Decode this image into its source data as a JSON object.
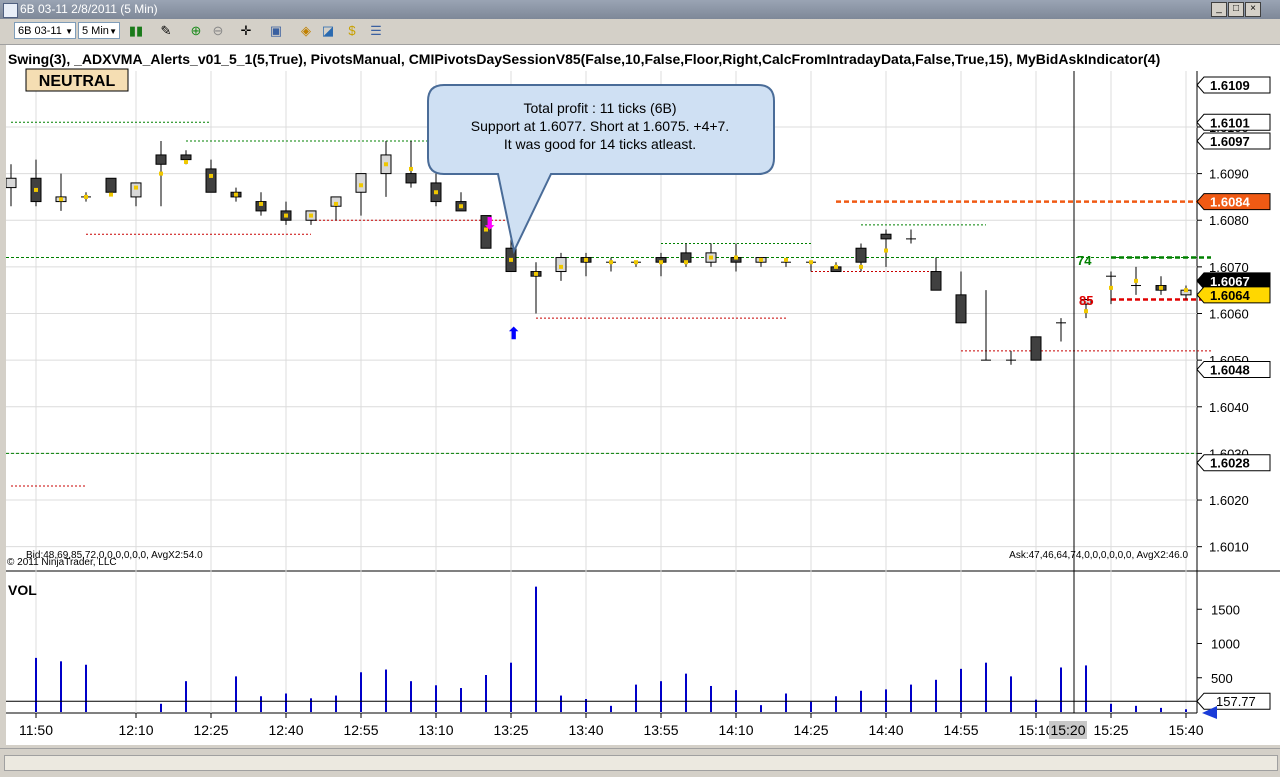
{
  "window": {
    "title": "6B 03-11  2/8/2011 (5 Min)",
    "controls": [
      "_",
      "□",
      "×"
    ]
  },
  "toolbar": {
    "instrument": "6B 03-11",
    "interval": "5 Min",
    "icons": [
      "bar-type-icon",
      "pencil-icon",
      "zoom-in-icon",
      "zoom-out-icon",
      "crosshair-icon",
      "properties-icon",
      "strategies-icon",
      "indicators-icon",
      "dollar-icon",
      "data-box-icon"
    ]
  },
  "chart": {
    "indicator_header": "Swing(3),  _ADXVMA_Alerts_v01_5_1(5,True),  PivotsManual,  CMIPivotsDaySessionV85(False,10,False,Floor,Right,CalcFromIntradayData,False,True,15),  MyBidAskIndicator(4)",
    "trend_badge": "NEUTRAL",
    "callout": {
      "line1": "Total profit : 11 ticks (6B)",
      "line2": "Support at 1.6077. Short at 1.6075. +4+7.",
      "line3": "It was good for 14 ticks atleast."
    },
    "bid_text": "Bid:48,69,85,72,0,0,0,0,0,0, AvgX2:54.0",
    "copyright": "© 2011 NinjaTrader, LLC",
    "ask_text": "Ask:47,46,64,74,0,0,0,0,0,0, AvgX2:46.0",
    "bid_ask_labels": {
      "ask_count": "74",
      "bid_count": "85"
    },
    "price_axis_ticks": [
      "1.6100",
      "1.6090",
      "1.6080",
      "1.6070",
      "1.6060",
      "1.6050",
      "1.6040",
      "1.6030",
      "1.6020",
      "1.6010"
    ],
    "price_axis_boxes": [
      {
        "label": "1.6109",
        "bg": "#ffffff",
        "fg": "#000000"
      },
      {
        "label": "1.6101",
        "bg": "#ffffff",
        "fg": "#000000"
      },
      {
        "label": "1.6097",
        "bg": "#ffffff",
        "fg": "#000000"
      },
      {
        "label": "1.6084",
        "bg": "#f05a14",
        "fg": "#ffffff"
      },
      {
        "label": "1.6067",
        "bg": "#000000",
        "fg": "#ffffff"
      },
      {
        "label": "1.6064",
        "bg": "#ffd700",
        "fg": "#000000"
      },
      {
        "label": "1.6048",
        "bg": "#ffffff",
        "fg": "#000000"
      },
      {
        "label": "1.6028",
        "bg": "#ffffff",
        "fg": "#000000"
      }
    ],
    "volume_panel": {
      "label": "VOL",
      "axis_ticks": [
        "1500",
        "1000",
        "500"
      ],
      "current_box": "157.77"
    },
    "time_axis": [
      "11:50",
      "12:10",
      "12:25",
      "12:40",
      "12:55",
      "13:10",
      "13:25",
      "13:40",
      "13:55",
      "14:10",
      "14:25",
      "14:40",
      "14:55",
      "15:10",
      "15:25",
      "15:40"
    ],
    "crosshair_time": "15:20",
    "colors": {
      "up_candle": "#d8d8d8",
      "down_candle": "#404040",
      "volume": "#0000c8",
      "pivot_green": "#008000",
      "pivot_red": "#c80000",
      "orange_level": "#f05a14",
      "adx_dots": "#f0c800",
      "sell_arrow": "#ff00ff",
      "buy_arrow": "#0000ff"
    }
  },
  "chart_data": {
    "type": "candlestick",
    "x": [
      "11:45",
      "11:50",
      "11:55",
      "12:00",
      "12:05",
      "12:10",
      "12:15",
      "12:20",
      "12:25",
      "12:30",
      "12:35",
      "12:40",
      "12:45",
      "12:50",
      "12:55",
      "13:00",
      "13:05",
      "13:10",
      "13:15",
      "13:20",
      "13:25",
      "13:30",
      "13:35",
      "13:40",
      "13:45",
      "13:50",
      "13:55",
      "14:00",
      "14:05",
      "14:10",
      "14:15",
      "14:20",
      "14:25",
      "14:30",
      "14:35",
      "14:40",
      "14:45",
      "14:50",
      "14:55",
      "15:00",
      "15:05",
      "15:10",
      "15:15",
      "15:20",
      "15:25",
      "15:30",
      "15:35",
      "15:40",
      "15:45"
    ],
    "open": [
      1.6087,
      1.6089,
      1.6084,
      1.6085,
      1.6089,
      1.6085,
      1.6094,
      1.6094,
      1.6091,
      1.6086,
      1.6084,
      1.6082,
      1.608,
      1.6083,
      1.6086,
      1.609,
      1.609,
      1.6088,
      1.6084,
      1.6081,
      1.6074,
      1.6069,
      1.6069,
      1.6072,
      1.6071,
      1.6071,
      1.6072,
      1.6073,
      1.6071,
      1.6072,
      1.6071,
      1.6071,
      1.6071,
      1.607,
      1.6074,
      1.6077,
      1.6076,
      1.6069,
      1.6064,
      1.605,
      1.605,
      1.6055,
      1.6058,
      1.6062,
      1.6068,
      1.6066,
      1.6066,
      1.6064,
      1.6064
    ],
    "high": [
      1.6092,
      1.6093,
      1.609,
      1.6086,
      1.6089,
      1.6088,
      1.6097,
      1.6095,
      1.6093,
      1.6087,
      1.6086,
      1.6084,
      1.6081,
      1.6083,
      1.609,
      1.6097,
      1.6097,
      1.609,
      1.6086,
      1.6081,
      1.6076,
      1.6071,
      1.6073,
      1.6073,
      1.6072,
      1.6071,
      1.6073,
      1.6075,
      1.6075,
      1.6075,
      1.6072,
      1.6071,
      1.6071,
      1.6071,
      1.6075,
      1.6078,
      1.6078,
      1.6072,
      1.6069,
      1.6065,
      1.6052,
      1.6055,
      1.6059,
      1.6063,
      1.6069,
      1.607,
      1.6068,
      1.6066,
      1.6065
    ],
    "low": [
      1.6083,
      1.6083,
      1.6082,
      1.6084,
      1.6088,
      1.6083,
      1.6083,
      1.6092,
      1.6086,
      1.6084,
      1.6081,
      1.6079,
      1.6079,
      1.608,
      1.6081,
      1.6085,
      1.6087,
      1.6083,
      1.6083,
      1.6075,
      1.6071,
      1.606,
      1.6067,
      1.6068,
      1.6069,
      1.607,
      1.6068,
      1.607,
      1.607,
      1.6069,
      1.607,
      1.607,
      1.6069,
      1.6069,
      1.6069,
      1.607,
      1.6075,
      1.6067,
      1.6058,
      1.605,
      1.6049,
      1.605,
      1.6054,
      1.6059,
      1.6062,
      1.6064,
      1.6064,
      1.6063,
      1.6063
    ],
    "close": [
      1.6089,
      1.6084,
      1.6085,
      1.6085,
      1.6086,
      1.6088,
      1.6092,
      1.6093,
      1.6086,
      1.6085,
      1.6082,
      1.608,
      1.6082,
      1.6085,
      1.609,
      1.6094,
      1.6088,
      1.6084,
      1.6082,
      1.6074,
      1.6069,
      1.6068,
      1.6072,
      1.6071,
      1.6071,
      1.6071,
      1.6071,
      1.6071,
      1.6073,
      1.6071,
      1.6072,
      1.6071,
      1.6071,
      1.6069,
      1.6071,
      1.6076,
      1.6076,
      1.6065,
      1.6058,
      1.605,
      1.605,
      1.605,
      1.6058,
      1.6063,
      1.6068,
      1.6066,
      1.6065,
      1.6065,
      1.6064
    ],
    "volume": [
      0,
      790,
      740,
      690,
      0,
      0,
      120,
      450,
      0,
      520,
      230,
      270,
      200,
      240,
      580,
      620,
      450,
      390,
      350,
      540,
      720,
      1830,
      240,
      190,
      90,
      400,
      450,
      560,
      380,
      320,
      100,
      270,
      150,
      230,
      310,
      330,
      400,
      470,
      630,
      720,
      520,
      180,
      650,
      680,
      120,
      90,
      60,
      40,
      30
    ],
    "ylim": [
      1.6005,
      1.6112
    ],
    "levels": [
      {
        "name": "pivot-green-top",
        "price": 1.6101,
        "color": "#008000",
        "from": "11:45",
        "to": "12:25"
      },
      {
        "name": "pivot-green-1",
        "price": 1.6097,
        "color": "#008000",
        "from": "12:20",
        "to": "13:20"
      },
      {
        "name": "pivot-red-1",
        "price": 1.6077,
        "color": "#c80000",
        "from": "12:00",
        "to": "12:45"
      },
      {
        "name": "pivot-red-2",
        "price": 1.608,
        "color": "#c80000",
        "from": "12:45",
        "to": "13:25"
      },
      {
        "name": "support-green",
        "price": 1.6075,
        "color": "#008000",
        "from": "13:55",
        "to": "14:25"
      },
      {
        "name": "mid-green",
        "price": 1.6079,
        "color": "#008000",
        "from": "14:35",
        "to": "15:00"
      },
      {
        "name": "orange-level",
        "price": 1.6084,
        "color": "#f05a14",
        "from": "14:30",
        "to": "15:45"
      },
      {
        "name": "red-low-1",
        "price": 1.6059,
        "color": "#c80000",
        "from": "13:30",
        "to": "14:20"
      },
      {
        "name": "red-low-2",
        "price": 1.6069,
        "color": "#c80000",
        "from": "14:25",
        "to": "14:50"
      },
      {
        "name": "red-low-3",
        "price": 1.6052,
        "color": "#c80000",
        "from": "14:55",
        "to": "15:45"
      },
      {
        "name": "red-bottom",
        "price": 1.6023,
        "color": "#c80000",
        "from": "11:45",
        "to": "12:00"
      },
      {
        "name": "ask-line",
        "price": 1.6072,
        "color": "#008000",
        "from": "15:25",
        "to": "15:45"
      },
      {
        "name": "bid-line",
        "price": 1.6063,
        "color": "#e00000",
        "from": "15:25",
        "to": "15:45"
      }
    ],
    "horizontal_lines": [
      {
        "price": 1.6072,
        "color": "#008000"
      },
      {
        "price": 1.603,
        "color": "#008000"
      }
    ]
  }
}
